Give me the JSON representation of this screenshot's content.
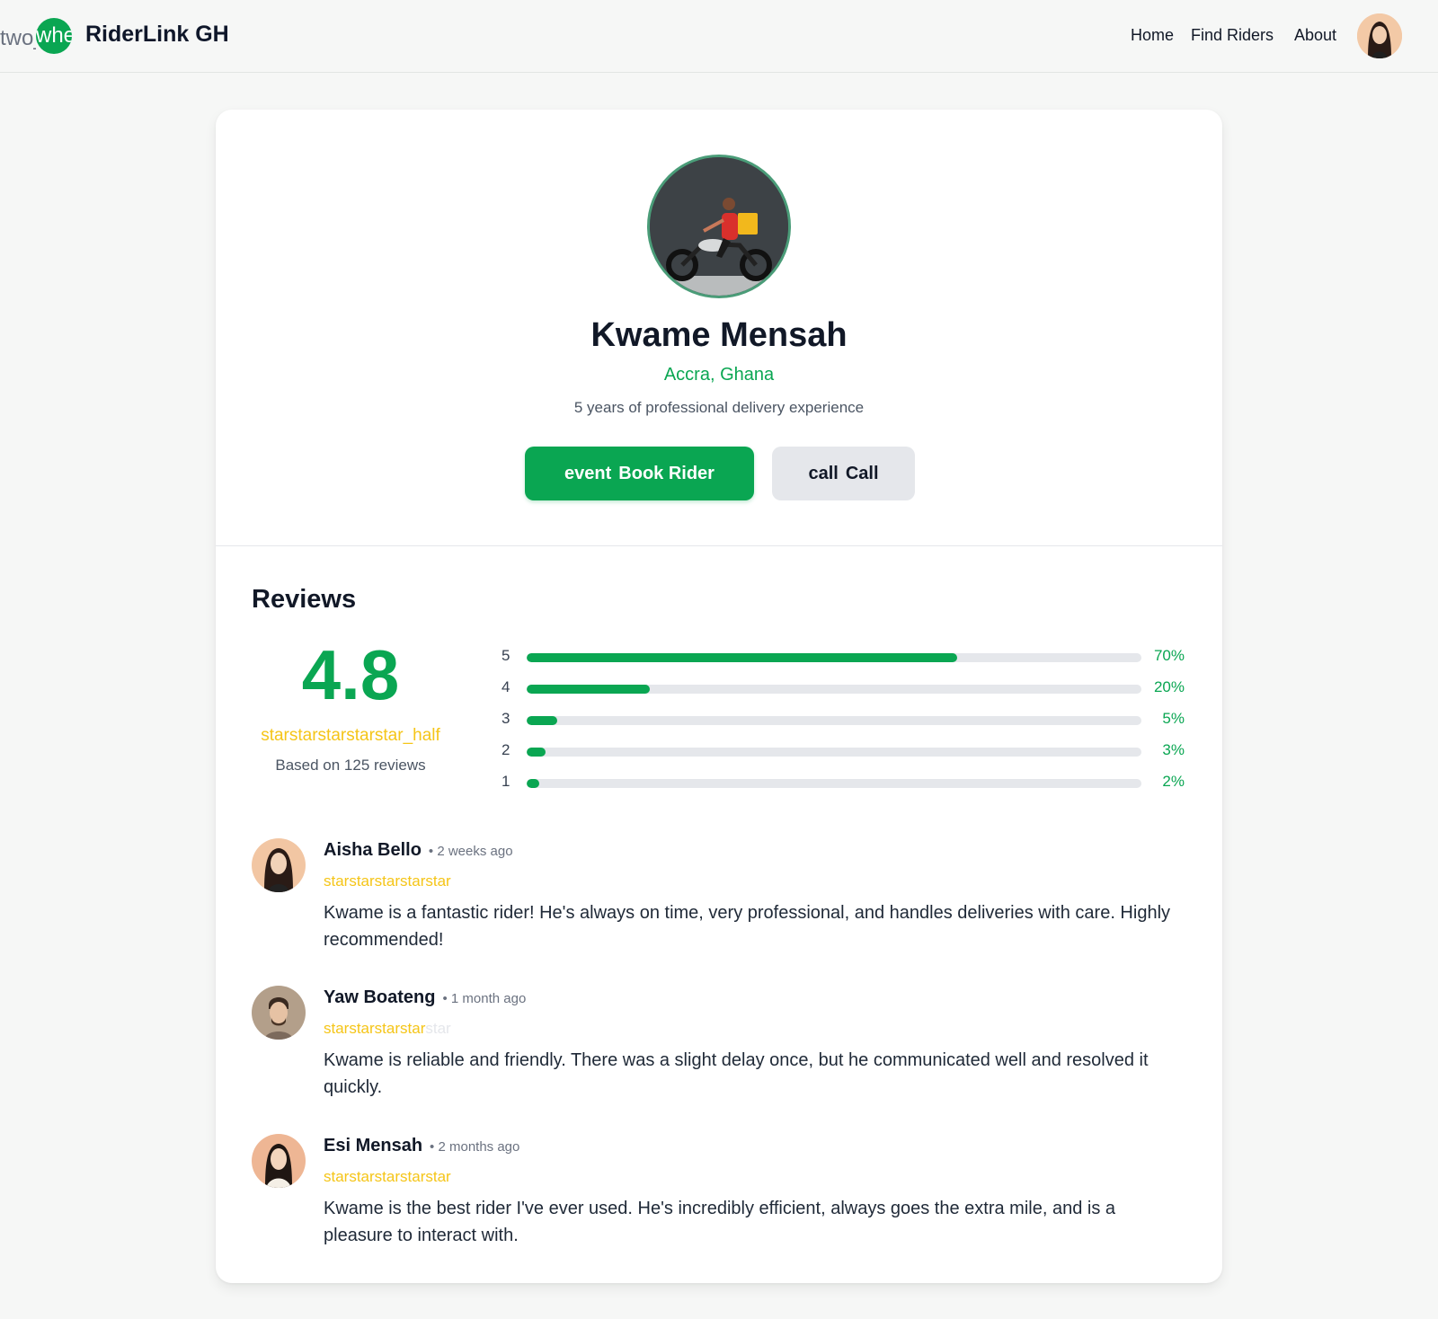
{
  "header": {
    "logo_ghost": "two_whe",
    "logo_icon_text": "whe",
    "brand": "RiderLink GH",
    "nav": [
      "Home",
      "Find Riders",
      "About"
    ]
  },
  "profile": {
    "name": "Kwame Mensah",
    "location": "Accra, Ghana",
    "experience": "5 years of professional delivery experience",
    "book_icon": "event",
    "book_label": "Book Rider",
    "call_icon": "call",
    "call_label": "Call"
  },
  "reviews": {
    "title": "Reviews",
    "average": "4.8",
    "average_stars": "starstarstarstarstar_half",
    "count_text": "Based on 125 reviews",
    "distribution": [
      {
        "label": "5",
        "pct_text": "70%",
        "fraction": 0.7
      },
      {
        "label": "4",
        "pct_text": "20%",
        "fraction": 0.2
      },
      {
        "label": "3",
        "pct_text": "5%",
        "fraction": 0.05
      },
      {
        "label": "2",
        "pct_text": "3%",
        "fraction": 0.03
      },
      {
        "label": "1",
        "pct_text": "2%",
        "fraction": 0.02
      }
    ],
    "items": [
      {
        "name": "Aisha Bello",
        "time": "• 2 weeks ago",
        "stars_filled": "starstarstarstarstar",
        "stars_empty": "",
        "rating": 5,
        "text": "Kwame is a fantastic rider! He's always on time, very professional, and handles deliveries with care. Highly recommended!"
      },
      {
        "name": "Yaw Boateng",
        "time": "• 1 month ago",
        "stars_filled": "starstarstarstar",
        "stars_empty": "star",
        "rating": 4,
        "text": "Kwame is reliable and friendly. There was a slight delay once, but he communicated well and resolved it quickly."
      },
      {
        "name": "Esi Mensah",
        "time": "• 2 months ago",
        "stars_filled": "starstarstarstarstar",
        "stars_empty": "",
        "rating": 5,
        "text": "Kwame is the best rider I've ever used. He's incredibly efficient, always goes the extra mile, and is a pleasure to interact with."
      }
    ]
  },
  "colors": {
    "accent": "#0aa652",
    "star": "#f5c518",
    "page_bg": "#f6f7f6"
  }
}
